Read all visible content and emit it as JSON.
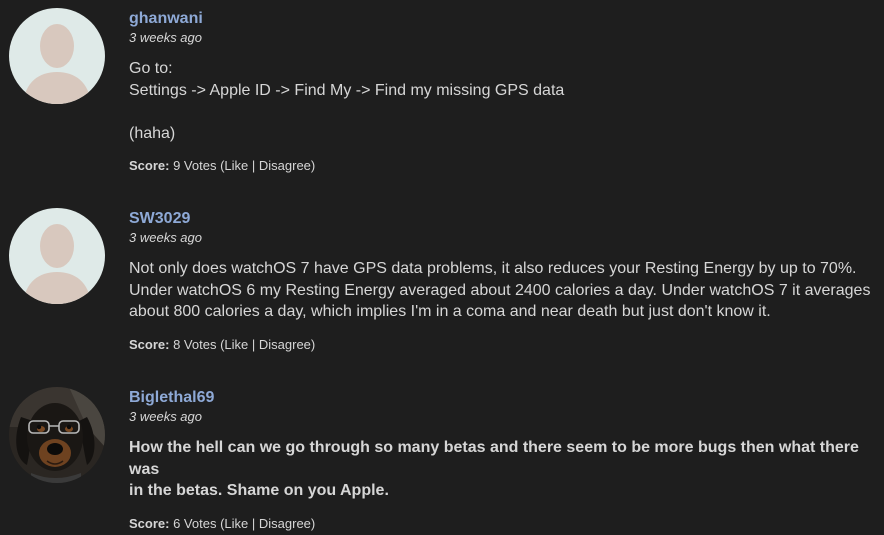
{
  "comments": [
    {
      "username": "ghanwani",
      "time": "3 weeks ago",
      "lines": [
        "Go to:",
        "Settings -> Apple ID -> Find My -> Find my missing GPS data",
        "",
        "(haha)"
      ],
      "score_label": "Score:",
      "votes": "9 Votes",
      "like": "Like",
      "disagree": "Disagree"
    },
    {
      "username": "SW3029",
      "time": "3 weeks ago",
      "lines": [
        "Not only does watchOS 7 have GPS data problems, it also reduces your Resting Energy by up to 70%.",
        "Under watchOS 6 my Resting Energy averaged about 2400 calories a day. Under watchOS 7 it averages",
        "about 800 calories a day, which implies I'm in a coma and near death but just don't know it."
      ],
      "score_label": "Score:",
      "votes": "8 Votes",
      "like": "Like",
      "disagree": "Disagree"
    },
    {
      "username": "Biglethal69",
      "time": "3 weeks ago",
      "lines": [
        "How the hell can we go through so many betas and there seem to be more bugs then what there was",
        "in the betas. Shame on you Apple."
      ],
      "score_label": "Score:",
      "votes": "6 Votes",
      "like": "Like",
      "disagree": "Disagree"
    }
  ],
  "colors": {
    "background": "#1e1e1e",
    "username": "#8ea9d6",
    "text": "#d6d6d6",
    "avatar_bg": "#dfeae8",
    "avatar_figure": "#d8c8be"
  },
  "icons": [
    "default-avatar-icon",
    "dog-avatar-image"
  ]
}
